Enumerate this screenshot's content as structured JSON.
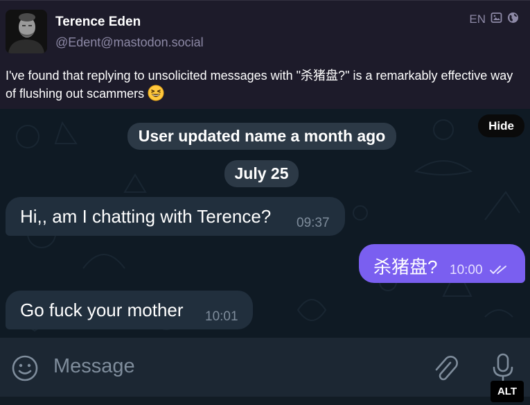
{
  "post": {
    "author_name": "Terence Eden",
    "author_handle": "@Edent@mastodon.social",
    "language": "EN",
    "icons": [
      "image-icon",
      "globe-icon"
    ],
    "text": "I've found that replying to unsolicited messages with \"杀猪盘?\" is a remarkably effective way of flushing out scammers",
    "emoji": "grinning-squinting-face-emoji"
  },
  "media": {
    "hide_label": "Hide",
    "alt_label": "ALT",
    "chat": {
      "service_message": "User updated name a month ago",
      "date_chip": "July 25",
      "messages": [
        {
          "direction": "incoming",
          "text": "Hi,, am I chatting with Terence?",
          "time": "09:37"
        },
        {
          "direction": "outgoing",
          "text": "杀猪盘?",
          "time": "10:00",
          "status": "read-double-check"
        },
        {
          "direction": "incoming",
          "text": "Go fuck your mother",
          "time": "10:01"
        }
      ],
      "composer": {
        "placeholder": "Message",
        "icons": [
          "emoji-smile-icon",
          "paperclip-icon",
          "microphone-icon"
        ]
      }
    }
  },
  "colors": {
    "post_background": "#1d1b2a",
    "handle_gray": "#8d89a6",
    "chat_background": "#0f1a24",
    "incoming_bubble": "#212f3d",
    "outgoing_bubble": "#7a5ff0",
    "composer_background": "#1c2733"
  }
}
